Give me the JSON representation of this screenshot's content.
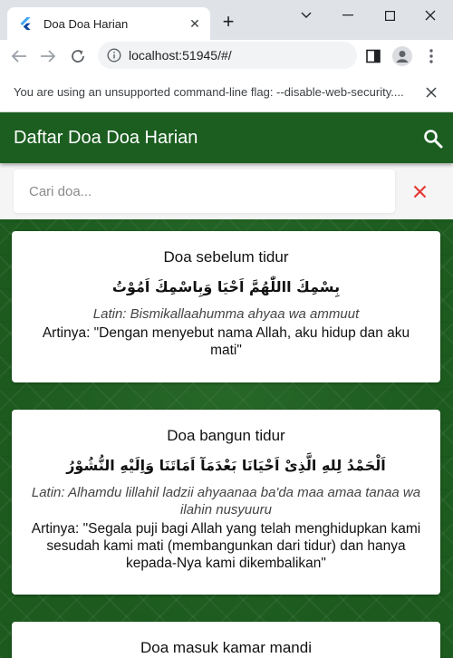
{
  "browser": {
    "tab_title": "Doa Doa Harian",
    "url": "localhost:51945/#/",
    "infobar_message": "You are using an unsupported command-line flag: --disable-web-security...."
  },
  "app": {
    "title": "Daftar Doa Doa Harian",
    "search_placeholder": "Cari doa...",
    "accent_color": "#1b5e20",
    "clear_color": "#e53935"
  },
  "doa": [
    {
      "title": "Doa sebelum tidur",
      "arabic": "بِسْمِكَ االلّٰهُمَّ اَحْيَا وَبِاسْمِكَ اَمُوْتُ",
      "latin": "Latin: Bismikallaahumma ahyaa wa ammuut",
      "arti": "Artinya: \"Dengan menyebut nama Allah, aku hidup dan aku mati\""
    },
    {
      "title": "Doa bangun tidur",
      "arabic": "اَلْحَمْدُ لِلهِ الَّذِىْ اَحْيَانَا بَعْدَمَآ اَمَاتَنَا وَاِلَيْهِ النُّشُوْرُ",
      "latin": "Latin: Alhamdu lillahil ladzii ahyaanaa ba'da maa amaa tanaa wa ilahin nusyuuru",
      "arti": "Artinya: \"Segala puji bagi Allah yang telah menghidupkan kami sesudah kami mati (membangunkan dari tidur) dan hanya kepada-Nya kami dikembalikan\""
    },
    {
      "title": "Doa masuk kamar mandi"
    }
  ]
}
